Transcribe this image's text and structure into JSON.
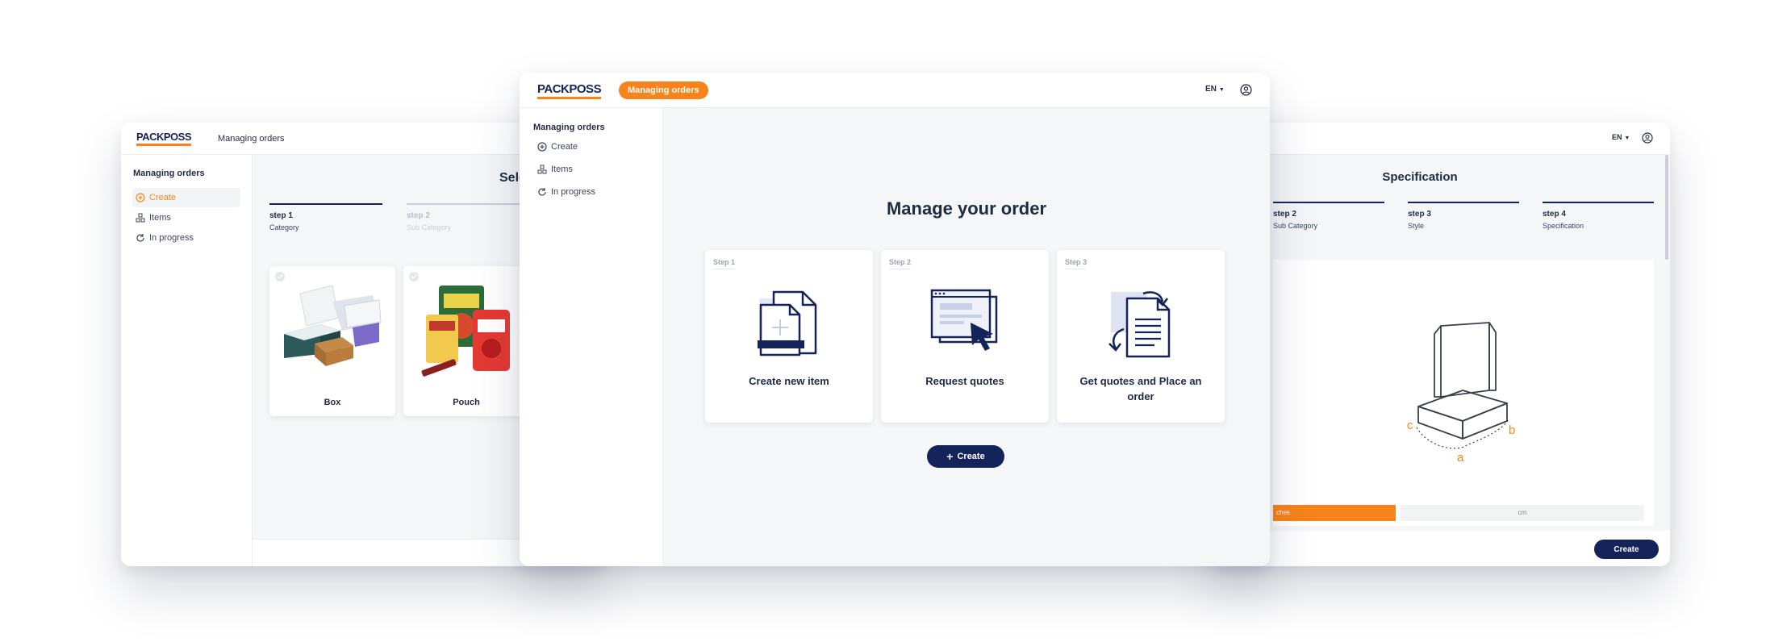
{
  "brand": {
    "name": "PACKPOSS",
    "accent": "#f7841a",
    "navy": "#14235a"
  },
  "left_window": {
    "header_label": "Managing orders",
    "sidebar": {
      "title": "Managing orders",
      "items": [
        {
          "label": "Create",
          "icon": "plus-circle-icon",
          "active": true
        },
        {
          "label": "Items",
          "icon": "boxes-icon"
        },
        {
          "label": "In progress",
          "icon": "refresh-icon"
        }
      ]
    },
    "page_title_partial": "Sele",
    "steps": [
      {
        "title": "step 1",
        "subtitle": "Category",
        "state": "active"
      },
      {
        "title": "step 2",
        "subtitle": "Sub Category",
        "state": "inactive"
      }
    ],
    "categories": [
      {
        "label": "Box",
        "image": "box-product-image"
      },
      {
        "label": "Pouch",
        "image": "pouch-product-image"
      }
    ]
  },
  "center_window": {
    "header_pill": "Managing orders",
    "language": "EN",
    "sidebar": {
      "title": "Managing orders",
      "items": [
        {
          "label": "Create",
          "icon": "plus-circle-icon"
        },
        {
          "label": "Items",
          "icon": "boxes-icon"
        },
        {
          "label": "In progress",
          "icon": "refresh-icon"
        }
      ]
    },
    "heading": "Manage your order",
    "cards": [
      {
        "step": "Step 1",
        "title": "Create new item",
        "icon": "document-copy-icon"
      },
      {
        "step": "Step 2",
        "title": "Request quotes",
        "icon": "browser-cursor-icon"
      },
      {
        "step": "Step 3",
        "title_line1": "Get quotes and Place an",
        "title_line2": "order",
        "icon": "document-exchange-icon"
      }
    ],
    "create_button": "Create"
  },
  "right_window": {
    "language": "EN",
    "title": "Specification",
    "steps": [
      {
        "title": "step 2",
        "subtitle": "Sub Category"
      },
      {
        "title": "step 3",
        "subtitle": "Style"
      },
      {
        "title": "step 4",
        "subtitle": "Specification"
      }
    ],
    "dimension_labels": {
      "a": "a",
      "b": "b",
      "c": "c"
    },
    "unit_left": "ches",
    "unit_right": "cm",
    "create_button": "Create"
  }
}
